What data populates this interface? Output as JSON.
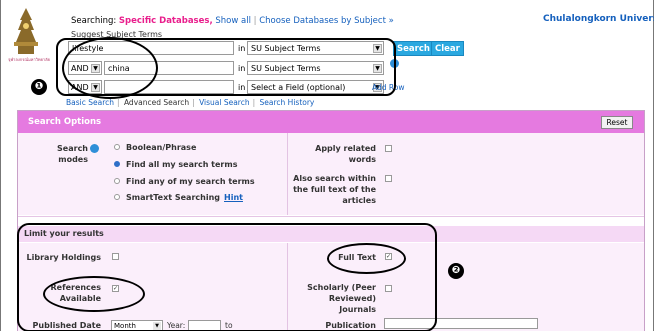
{
  "header": {
    "logo_caption": "จุฬาลงกรณ์มหาวิทยาลัย",
    "searching_prefix": "Searching:",
    "searching_databases": "Specific Databases,",
    "show_all": "Show all",
    "choose_by_subject": "Choose Databases by Subject »",
    "suggest_subject": "Suggest Subject Terms",
    "university": "Chulalongkorn University"
  },
  "search_rows": [
    {
      "bool": "",
      "term": "lifestyle",
      "in_label": "in",
      "field": "SU Subject Terms"
    },
    {
      "bool": "AND",
      "term": "china",
      "in_label": "in",
      "field": "SU Subject Terms"
    },
    {
      "bool": "AND",
      "term": "",
      "in_label": "in",
      "field": "Select a Field (optional)"
    }
  ],
  "buttons": {
    "search": "Search",
    "clear": "Clear",
    "add_row": "Add Row"
  },
  "tabs": {
    "basic": "Basic Search",
    "advanced": "Advanced Search",
    "visual": "Visual Search",
    "history": "Search History"
  },
  "annotations": {
    "badge1": "❶",
    "badge2": "❷"
  },
  "search_options": {
    "title": "Search Options",
    "reset": "Reset",
    "modes_label": "Search modes",
    "modes": [
      {
        "label": "Boolean/Phrase",
        "selected": false
      },
      {
        "label": "Find all my search terms",
        "selected": true
      },
      {
        "label": "Find any of my search terms",
        "selected": false
      },
      {
        "label": "SmartText Searching",
        "selected": false,
        "hint": "Hint"
      }
    ],
    "apply_related": "Apply related words",
    "full_text_search_lines": [
      "Also search within",
      "the full text of the",
      "articles"
    ]
  },
  "limit": {
    "title": "Limit your results",
    "library_holdings": {
      "label": "Library Holdings",
      "checked": false
    },
    "full_text": {
      "label": "Full Text",
      "checked": true
    },
    "references_lines": [
      "References",
      "Available"
    ],
    "references_checked": true,
    "scholarly_lines": [
      "Scholarly (Peer",
      "Reviewed) Journals"
    ],
    "scholarly_checked": false,
    "published_date": "Published Date",
    "month": "Month",
    "year": "Year:",
    "to": "to",
    "publication": "Publication"
  },
  "colors": {
    "accent_pink": "#e57ae0",
    "link_blue": "#1560bd",
    "button_blue": "#2aa8e0"
  }
}
